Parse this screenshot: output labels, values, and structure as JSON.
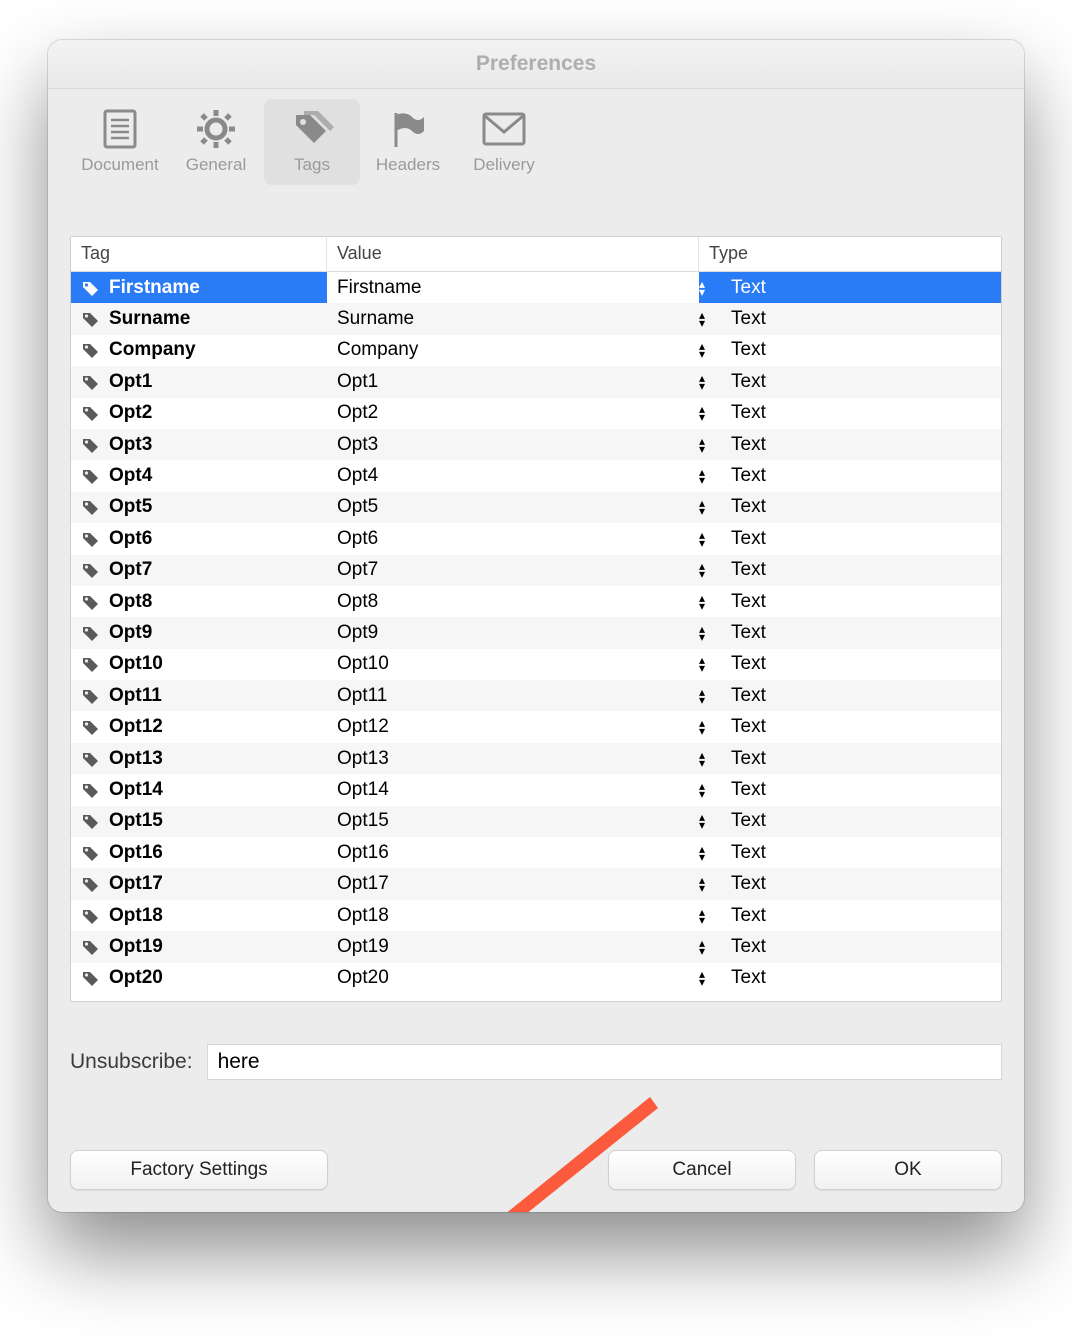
{
  "window": {
    "title": "Preferences"
  },
  "toolbar": {
    "items": [
      {
        "label": "Document"
      },
      {
        "label": "General"
      },
      {
        "label": "Tags"
      },
      {
        "label": "Headers"
      },
      {
        "label": "Delivery"
      }
    ],
    "selected_index": 2
  },
  "table": {
    "columns": {
      "tag": "Tag",
      "value": "Value",
      "type": "Type"
    },
    "selected_index": 0,
    "rows": [
      {
        "tag": "Firstname",
        "value": "Firstname",
        "type": "Text"
      },
      {
        "tag": "Surname",
        "value": "Surname",
        "type": "Text"
      },
      {
        "tag": "Company",
        "value": "Company",
        "type": "Text"
      },
      {
        "tag": "Opt1",
        "value": "Opt1",
        "type": "Text"
      },
      {
        "tag": "Opt2",
        "value": "Opt2",
        "type": "Text"
      },
      {
        "tag": "Opt3",
        "value": "Opt3",
        "type": "Text"
      },
      {
        "tag": "Opt4",
        "value": "Opt4",
        "type": "Text"
      },
      {
        "tag": "Opt5",
        "value": "Opt5",
        "type": "Text"
      },
      {
        "tag": "Opt6",
        "value": "Opt6",
        "type": "Text"
      },
      {
        "tag": "Opt7",
        "value": "Opt7",
        "type": "Text"
      },
      {
        "tag": "Opt8",
        "value": "Opt8",
        "type": "Text"
      },
      {
        "tag": "Opt9",
        "value": "Opt9",
        "type": "Text"
      },
      {
        "tag": "Opt10",
        "value": "Opt10",
        "type": "Text"
      },
      {
        "tag": "Opt11",
        "value": "Opt11",
        "type": "Text"
      },
      {
        "tag": "Opt12",
        "value": "Opt12",
        "type": "Text"
      },
      {
        "tag": "Opt13",
        "value": "Opt13",
        "type": "Text"
      },
      {
        "tag": "Opt14",
        "value": "Opt14",
        "type": "Text"
      },
      {
        "tag": "Opt15",
        "value": "Opt15",
        "type": "Text"
      },
      {
        "tag": "Opt16",
        "value": "Opt16",
        "type": "Text"
      },
      {
        "tag": "Opt17",
        "value": "Opt17",
        "type": "Text"
      },
      {
        "tag": "Opt18",
        "value": "Opt18",
        "type": "Text"
      },
      {
        "tag": "Opt19",
        "value": "Opt19",
        "type": "Text"
      },
      {
        "tag": "Opt20",
        "value": "Opt20",
        "type": "Text"
      }
    ]
  },
  "unsubscribe": {
    "label": "Unsubscribe:",
    "value": "here"
  },
  "buttons": {
    "factory": "Factory Settings",
    "cancel": "Cancel",
    "ok": "OK"
  }
}
